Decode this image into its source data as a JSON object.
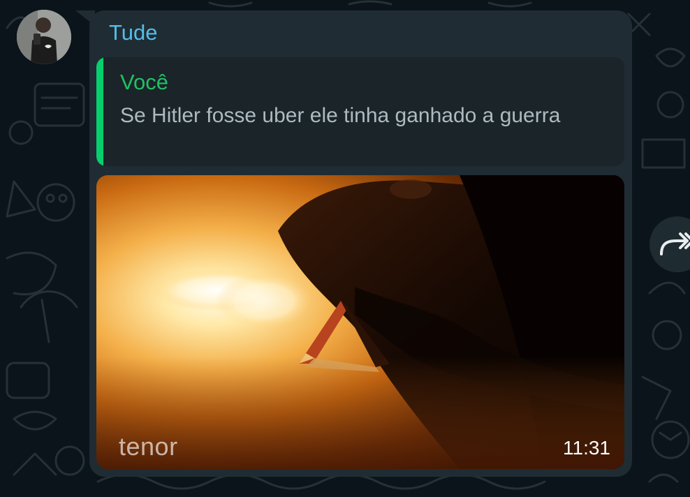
{
  "chat": {
    "sender_name": "Tude",
    "quoted": {
      "author": "Você",
      "text": "Se Hitler fosse uber ele tinha ganhado a guerra"
    },
    "media": {
      "watermark": "tenor",
      "timestamp": "11:31"
    }
  },
  "icons": {
    "avatar": "avatar-photo",
    "forward": "forward-arrow-icon"
  },
  "colors": {
    "background": "#0b141a",
    "bubble": "#202c33",
    "sender_name": "#53bdeb",
    "quote_bar": "#06cf6e",
    "quote_author": "#21c063",
    "quote_text": "#aebac1"
  }
}
